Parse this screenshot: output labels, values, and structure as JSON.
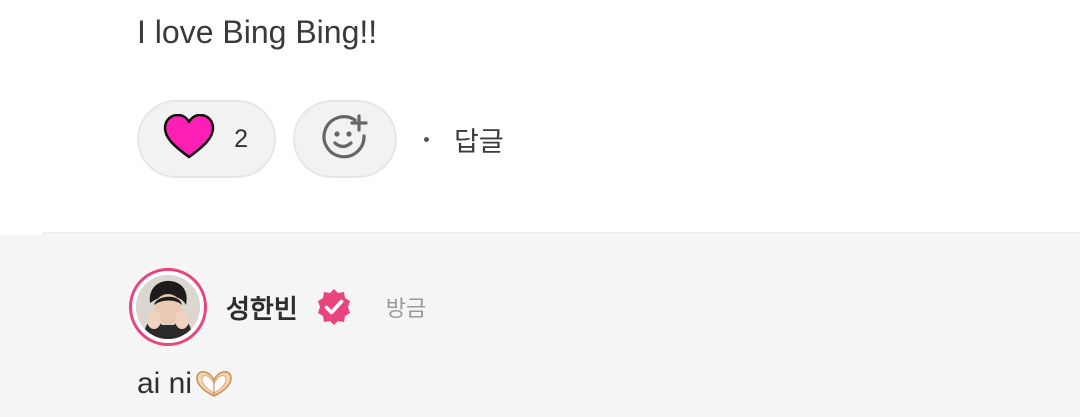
{
  "comment": {
    "text": "I love Bing Bing!!",
    "like_count": "2",
    "dot": "·",
    "reply_label": "답글",
    "icons": {
      "like": "heart-icon",
      "react": "add-emoji-icon"
    },
    "colors": {
      "heart": "#ff1fb4",
      "pill_bg": "#f2f2f2"
    }
  },
  "reply": {
    "author": "성한빈",
    "time": "방금",
    "text": "ai ni",
    "emoji": "heart-hands-emoji",
    "icons": {
      "badge": "verified-badge-icon",
      "avatar": "avatar-photo"
    },
    "colors": {
      "badge": "#e8457e",
      "avatar_ring": "#e8457e",
      "section_bg": "#f5f5f5"
    }
  }
}
